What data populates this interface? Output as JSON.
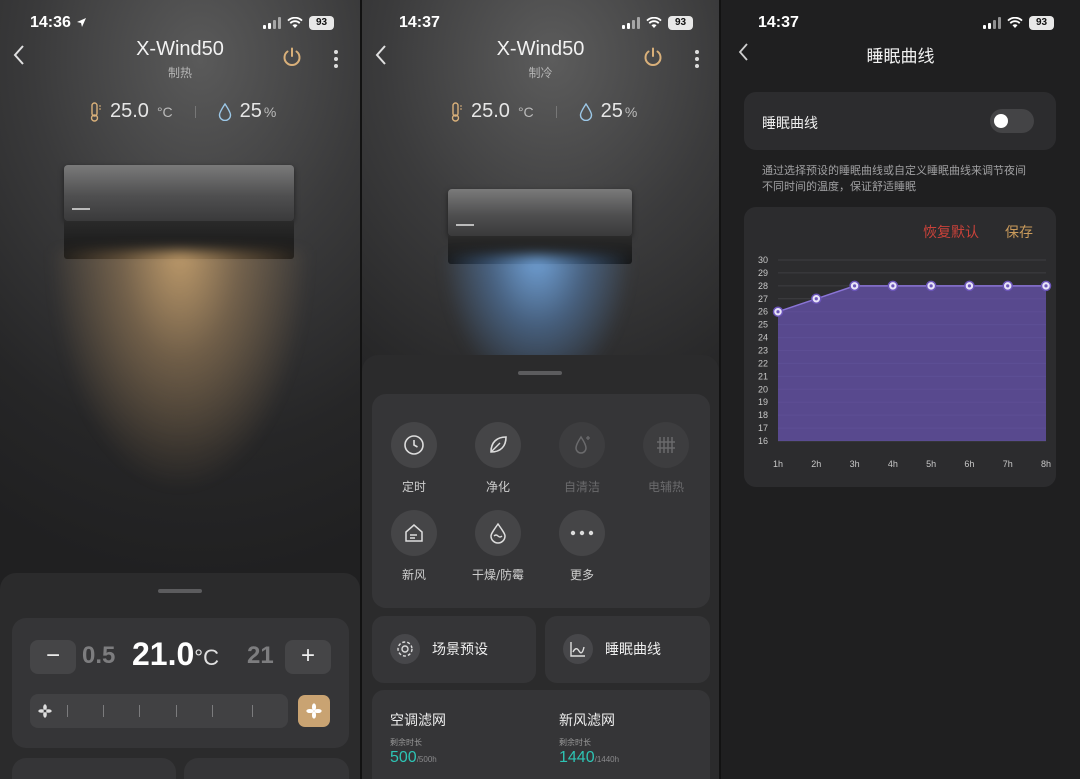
{
  "colors": {
    "accent_gold": "#c9a372",
    "reset_red": "#c9423a",
    "save_gold": "#c99a5b",
    "filter_teal": "#2dc4b4",
    "curve_purple": "#6b55b8"
  },
  "screens": [
    {
      "status": {
        "time": "14:36",
        "battery": "93",
        "location_arrow": true
      },
      "header": {
        "title": "X-Wind50",
        "mode": "制热"
      },
      "readout": {
        "temperature": "25.0",
        "temp_unit": "°C",
        "humidity": "25",
        "humidity_unit": "%"
      },
      "airflow": "warm",
      "control": {
        "minus_label": "−",
        "plus_label": "+",
        "prev_temp": "0.5",
        "current_temp": "21.0",
        "temp_unit": "°C",
        "next_temp": "21"
      }
    },
    {
      "status": {
        "time": "14:37",
        "battery": "93"
      },
      "header": {
        "title": "X-Wind50",
        "mode": "制冷"
      },
      "readout": {
        "temperature": "25.0",
        "temp_unit": "°C",
        "humidity": "25",
        "humidity_unit": "%"
      },
      "airflow": "cool",
      "features": [
        {
          "label": "定时",
          "icon": "clock-icon",
          "enabled": true
        },
        {
          "label": "净化",
          "icon": "leaf-icon",
          "enabled": true
        },
        {
          "label": "自清洁",
          "icon": "drop-sparkle-icon",
          "enabled": false
        },
        {
          "label": "电辅热",
          "icon": "heater-grid-icon",
          "enabled": false
        },
        {
          "label": "新风",
          "icon": "house-wind-icon",
          "enabled": true
        },
        {
          "label": "干燥/防霉",
          "icon": "drop-wave-icon",
          "enabled": true
        },
        {
          "label": "更多",
          "icon": "more-dots-icon",
          "enabled": true
        }
      ],
      "scene_preset": "场景预设",
      "sleep_curve": "睡眠曲线",
      "filters": [
        {
          "title": "空调滤网",
          "sub": "剩余时长",
          "value": "500",
          "max": "/500h"
        },
        {
          "title": "新风滤网",
          "sub": "剩余时长",
          "value": "1440",
          "max": "/1440h"
        }
      ]
    },
    {
      "status": {
        "time": "14:37",
        "battery": "93"
      },
      "header": {
        "title": "睡眠曲线"
      },
      "toggle": {
        "label": "睡眠曲线",
        "on": false
      },
      "description": [
        "通过选择预设的睡眠曲线或自定义睡眠曲线来调节夜间",
        "不同时间的温度，保证舒适睡眠"
      ],
      "reset_label": "恢复默认",
      "save_label": "保存"
    }
  ],
  "chart_data": {
    "type": "area",
    "x": [
      "1h",
      "2h",
      "3h",
      "4h",
      "5h",
      "6h",
      "7h",
      "8h"
    ],
    "values": [
      26,
      27,
      28,
      28,
      28,
      28,
      28,
      28
    ],
    "ylim": [
      16,
      30
    ],
    "yticks": [
      "30",
      "29",
      "28",
      "27",
      "26",
      "25",
      "24",
      "23",
      "22",
      "21",
      "20",
      "19",
      "18",
      "17",
      "16"
    ],
    "grid": true
  }
}
